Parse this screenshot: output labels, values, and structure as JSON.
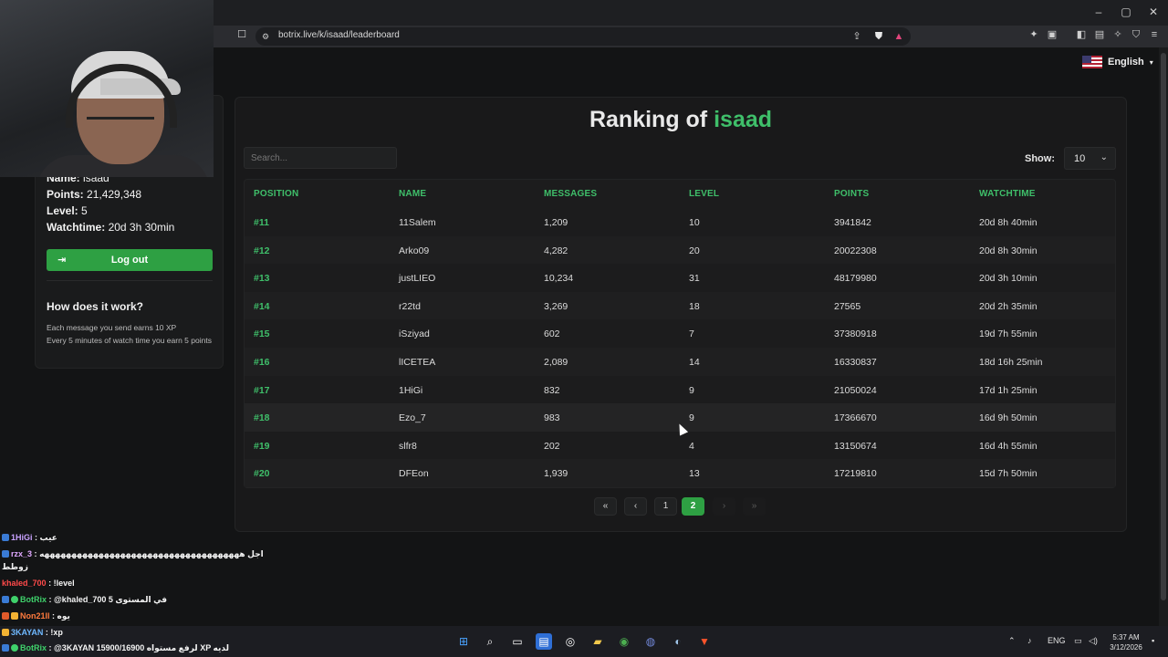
{
  "browser": {
    "url": "botrix.live/k/isaad/leaderboard",
    "language": "English"
  },
  "sidebar": {
    "name_label": "Name:",
    "name_value": "isaad",
    "points_label": "Points:",
    "points_value": "21,429,348",
    "level_label": "Level:",
    "level_value": "5",
    "watchtime_label": "Watchtime:",
    "watchtime_value": "20d 3h 30min",
    "logout_label": "Log out",
    "how_title": "How does it work?",
    "how_line1": "Each message you send earns 10 XP",
    "how_line2": "Every 5 minutes of watch time you earn 5 points"
  },
  "leaderboard": {
    "title_prefix": "Ranking of",
    "title_name": "isaad",
    "search_placeholder": "Search...",
    "show_label": "Show:",
    "show_value": "10",
    "columns": [
      "POSITION",
      "NAME",
      "MESSAGES",
      "LEVEL",
      "POINTS",
      "WATCHTIME"
    ],
    "rows": [
      {
        "position": "#11",
        "name": "11Salem",
        "messages": "1,209",
        "level": "10",
        "points": "3941842",
        "watchtime": "20d 8h 40min"
      },
      {
        "position": "#12",
        "name": "Arko09",
        "messages": "4,282",
        "level": "20",
        "points": "20022308",
        "watchtime": "20d 8h 30min"
      },
      {
        "position": "#13",
        "name": "justLIEO",
        "messages": "10,234",
        "level": "31",
        "points": "48179980",
        "watchtime": "20d 3h 10min"
      },
      {
        "position": "#14",
        "name": "r22td",
        "messages": "3,269",
        "level": "18",
        "points": "27565",
        "watchtime": "20d 2h 35min"
      },
      {
        "position": "#15",
        "name": "iSziyad",
        "messages": "602",
        "level": "7",
        "points": "37380918",
        "watchtime": "19d 7h 55min"
      },
      {
        "position": "#16",
        "name": "lICETEA",
        "messages": "2,089",
        "level": "14",
        "points": "16330837",
        "watchtime": "18d 16h 25min"
      },
      {
        "position": "#17",
        "name": "1HiGi",
        "messages": "832",
        "level": "9",
        "points": "21050024",
        "watchtime": "17d 1h 25min"
      },
      {
        "position": "#18",
        "name": "Ezo_7",
        "messages": "983",
        "level": "9",
        "points": "17366670",
        "watchtime": "16d 9h 50min"
      },
      {
        "position": "#19",
        "name": "slfr8",
        "messages": "202",
        "level": "4",
        "points": "13150674",
        "watchtime": "16d 4h 55min"
      },
      {
        "position": "#20",
        "name": "DFEon",
        "messages": "1,939",
        "level": "13",
        "points": "17219810",
        "watchtime": "15d 7h 50min"
      }
    ],
    "pagination": {
      "first": "«",
      "prev": "‹",
      "pages": [
        "1",
        "2"
      ],
      "current": "2",
      "next": "›",
      "last": "»"
    }
  },
  "chat": [
    {
      "user": "1HiGi",
      "sep": ":",
      "msg": "عيب",
      "color": "#c9a2ff"
    },
    {
      "user": "rzx_3",
      "sep": ":",
      "msg": "اجل هههههههههههههههههههههههههههههههههههههه",
      "color": "#e0a8ff"
    },
    {
      "user": "",
      "sep": "",
      "msg": "زوطط",
      "color": "#f4f4f4"
    },
    {
      "user": "khaled_700",
      "sep": ":",
      "msg": "!level",
      "color": "#ff4a4a"
    },
    {
      "user": "BotRix",
      "sep": ":",
      "msg": "@khaled_700 في المستوى 5",
      "color": "#3fd16b"
    },
    {
      "user": "Non21ll",
      "sep": ":",
      "msg": "يوه",
      "color": "#ff7a3d"
    },
    {
      "user": "3KAYAN",
      "sep": ":",
      "msg": "!xp",
      "color": "#6fb8ff"
    },
    {
      "user": "BotRix",
      "sep": ":",
      "msg": "@3KAYAN 15900/16900 لرفع مستواه XP لديه",
      "color": "#3fd16b"
    }
  ],
  "taskbar": {
    "lang": "ENG",
    "time": "5:37 AM",
    "date": "3/12/2026"
  },
  "colors": {
    "accent": "#3fbf6a",
    "button": "#2ea043",
    "background": "#131415",
    "card": "#19191a"
  }
}
